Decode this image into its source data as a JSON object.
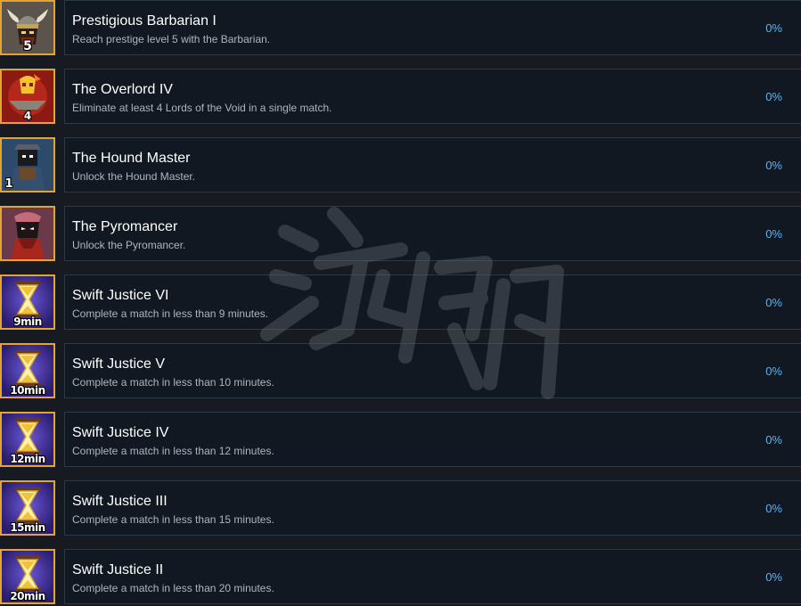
{
  "achievements": [
    {
      "title": "Prestigious Barbarian I",
      "description": "Reach prestige level 5 with the Barbarian.",
      "percent": "0%",
      "icon": "barbarian-helmet-icon",
      "badge": "5"
    },
    {
      "title": "The Overlord IV",
      "description": "Eliminate at least 4 Lords of the Void in a single match.",
      "percent": "0%",
      "icon": "overlord-skull-icon",
      "badge": "4"
    },
    {
      "title": "The Hound Master",
      "description": "Unlock the Hound Master.",
      "percent": "0%",
      "icon": "hound-master-portrait-icon",
      "badge": "1"
    },
    {
      "title": "The Pyromancer",
      "description": "Unlock the Pyromancer.",
      "percent": "0%",
      "icon": "pyromancer-portrait-icon",
      "badge": ""
    },
    {
      "title": "Swift Justice VI",
      "description": "Complete a match in less than 9 minutes.",
      "percent": "0%",
      "icon": "hourglass-icon",
      "badge": "9min"
    },
    {
      "title": "Swift Justice V",
      "description": "Complete a match in less than 10 minutes.",
      "percent": "0%",
      "icon": "hourglass-icon",
      "badge": "10min"
    },
    {
      "title": "Swift Justice IV",
      "description": "Complete a match in less than 12 minutes.",
      "percent": "0%",
      "icon": "hourglass-icon",
      "badge": "12min"
    },
    {
      "title": "Swift Justice III",
      "description": "Complete a match in less than 15 minutes.",
      "percent": "0%",
      "icon": "hourglass-icon",
      "badge": "15min"
    },
    {
      "title": "Swift Justice II",
      "description": "Complete a match in less than 20 minutes.",
      "percent": "0%",
      "icon": "hourglass-icon",
      "badge": "20min"
    }
  ],
  "colors": {
    "background": "#171a21",
    "card": "#111821",
    "frame": "#e2a533",
    "percent": "#5fb3f0",
    "hourglass_bg": "#3b2a8c"
  }
}
